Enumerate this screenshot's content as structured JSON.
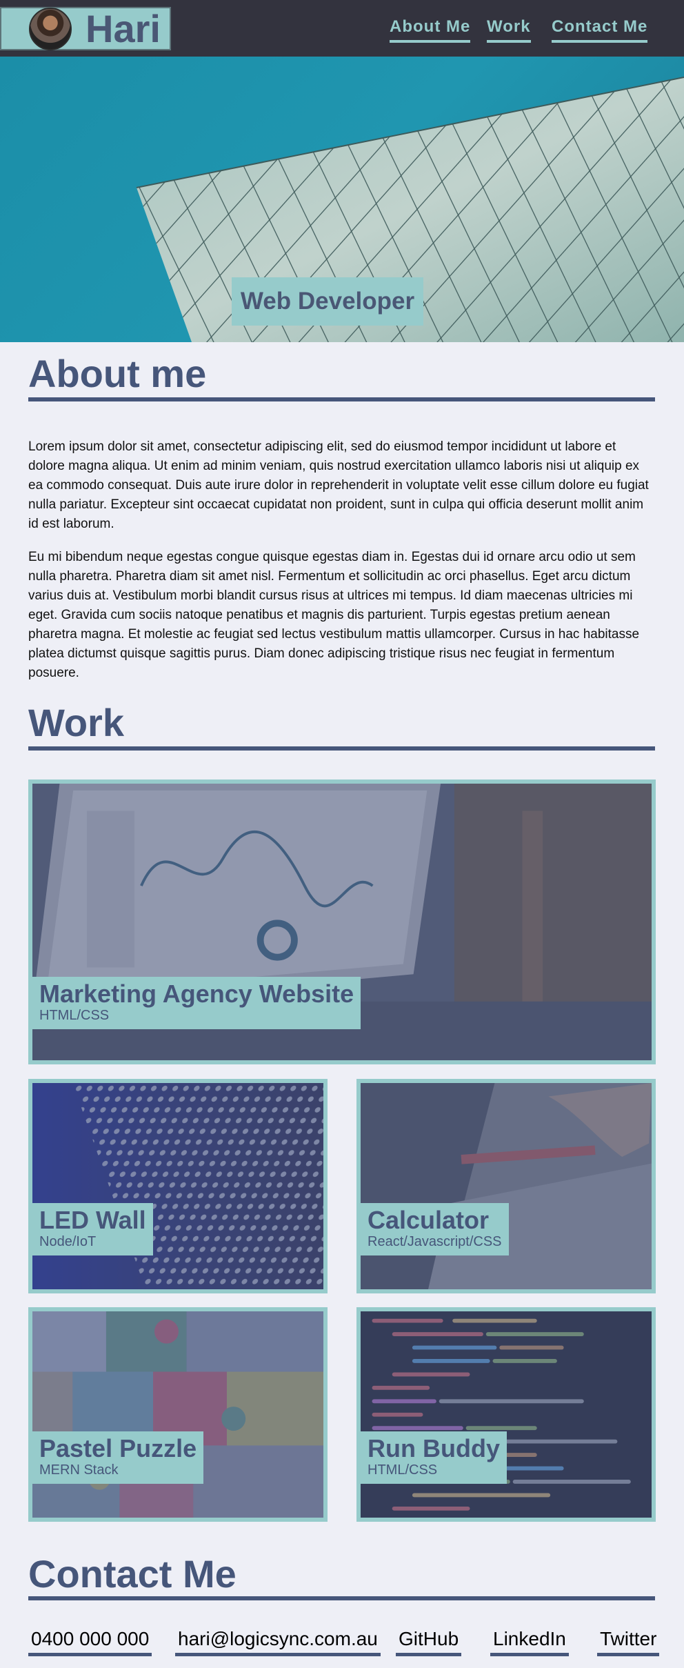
{
  "header": {
    "brand_name": "Hari",
    "nav": [
      {
        "label": "About Me"
      },
      {
        "label": "Work"
      },
      {
        "label": "Contact Me"
      }
    ]
  },
  "hero": {
    "title": "Web Developer"
  },
  "about": {
    "title": "About me",
    "paragraphs": [
      "Lorem ipsum dolor sit amet, consectetur adipiscing elit, sed do eiusmod tempor incididunt ut labore et dolore magna aliqua. Ut enim ad minim veniam, quis nostrud exercitation ullamco laboris nisi ut aliquip ex ea commodo consequat. Duis aute irure dolor in reprehenderit in voluptate velit esse cillum dolore eu fugiat nulla pariatur. Excepteur sint occaecat cupidatat non proident, sunt in culpa qui officia deserunt mollit anim id est laborum.",
      "Eu mi bibendum neque egestas congue quisque egestas diam in. Egestas dui id ornare arcu odio ut sem nulla pharetra. Pharetra diam sit amet nisl. Fermentum et sollicitudin ac orci phasellus. Eget arcu dictum varius duis at. Vestibulum morbi blandit cursus risus at ultrices mi tempus. Id diam maecenas ultricies mi eget. Gravida cum sociis natoque penatibus et magnis dis parturient. Turpis egestas pretium aenean pharetra magna. Et molestie ac feugiat sed lectus vestibulum mattis ullamcorper. Cursus in hac habitasse platea dictumst quisque sagittis purus. Diam donec adipiscing tristique risus nec feugiat in fermentum posuere."
    ]
  },
  "work": {
    "title": "Work",
    "projects": [
      {
        "title": "Marketing Agency Website",
        "stack": "HTML/CSS"
      },
      {
        "title": "LED Wall",
        "stack": "Node/IoT"
      },
      {
        "title": "Calculator",
        "stack": "React/Javascript/CSS"
      },
      {
        "title": "Pastel Puzzle",
        "stack": "MERN Stack"
      },
      {
        "title": "Run Buddy",
        "stack": "HTML/CSS"
      }
    ]
  },
  "contact": {
    "title": "Contact Me",
    "links": [
      {
        "label": "0400 000 000"
      },
      {
        "label": "hari@logicsync.com.au"
      },
      {
        "label": "GitHub"
      },
      {
        "label": "LinkedIn"
      },
      {
        "label": "Twitter"
      }
    ]
  },
  "colors": {
    "header_bg": "#33333e",
    "accent": "#96cbcb",
    "heading": "#46567a",
    "page_bg": "#eeeff6"
  }
}
